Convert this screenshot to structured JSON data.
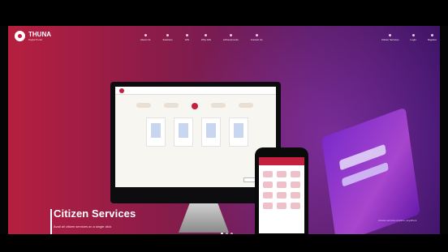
{
  "brand": {
    "name": "THUNA",
    "tagline": "Digital Portal",
    "accent": "#c62040"
  },
  "nav": {
    "items": [
      "About Us",
      "Solutions",
      "GIS",
      "Why GIS",
      "Achievements",
      "Contact Us"
    ]
  },
  "nav_right": {
    "items": [
      "Citizen Services",
      "Login",
      "Register"
    ]
  },
  "hero": {
    "title": "Citizen Services",
    "subtitle": "Avail all citizen services on a single click"
  },
  "mockup": {
    "button": "Apply"
  },
  "right_caption": "Access services anytime, anywhere",
  "carousel": {
    "count": 3,
    "active": 0
  }
}
